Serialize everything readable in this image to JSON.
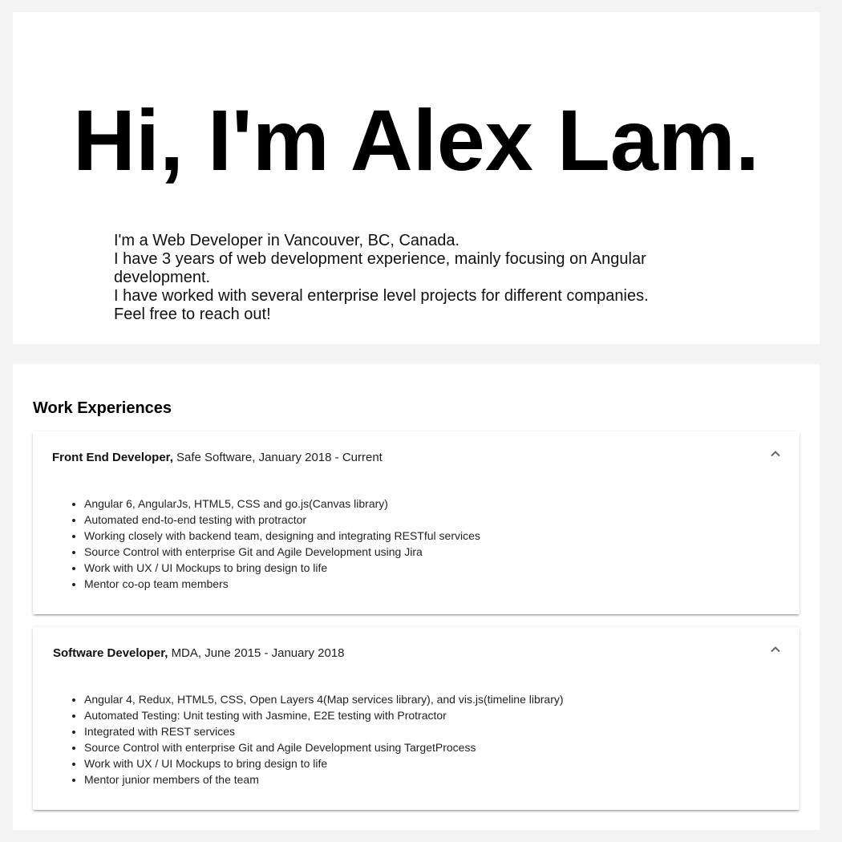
{
  "hero": {
    "title": "Hi, I'm Alex Lam.",
    "intro": [
      "I'm a Web Developer in Vancouver, BC, Canada.",
      "I have 3 years of web development experience, mainly focusing on Angular development.",
      "I have worked with several enterprise level projects for different companies.",
      "Feel free to reach out!"
    ]
  },
  "work": {
    "heading": "Work Experiences",
    "jobs": [
      {
        "title": "Front End Developer,",
        "details": "Safe Software, January 2018 - Current",
        "icon": "chevron-up-icon",
        "items": [
          "Angular 6, AngularJs, HTML5, CSS and go.js(Canvas library)",
          "Automated end-to-end testing with protractor",
          "Working closely with backend team, designing and integrating RESTful services",
          "Source Control with enterprise Git and Agile Development using Jira",
          "Work with UX / UI Mockups to bring design to life",
          "Mentor co-op team members"
        ]
      },
      {
        "title": "Software Developer,",
        "details": "MDA, June 2015 - January 2018",
        "icon": "chevron-up-icon",
        "items": [
          "Angular 4, Redux, HTML5, CSS, Open Layers 4(Map services library), and vis.js(timeline library)",
          "Automated Testing: Unit testing with Jasmine, E2E testing with Protractor",
          "Integrated with REST services",
          "Source Control with enterprise Git and Agile Development using TargetProcess",
          "Work with UX / UI Mockups to bring design to life",
          "Mentor junior members of the team"
        ]
      }
    ]
  }
}
